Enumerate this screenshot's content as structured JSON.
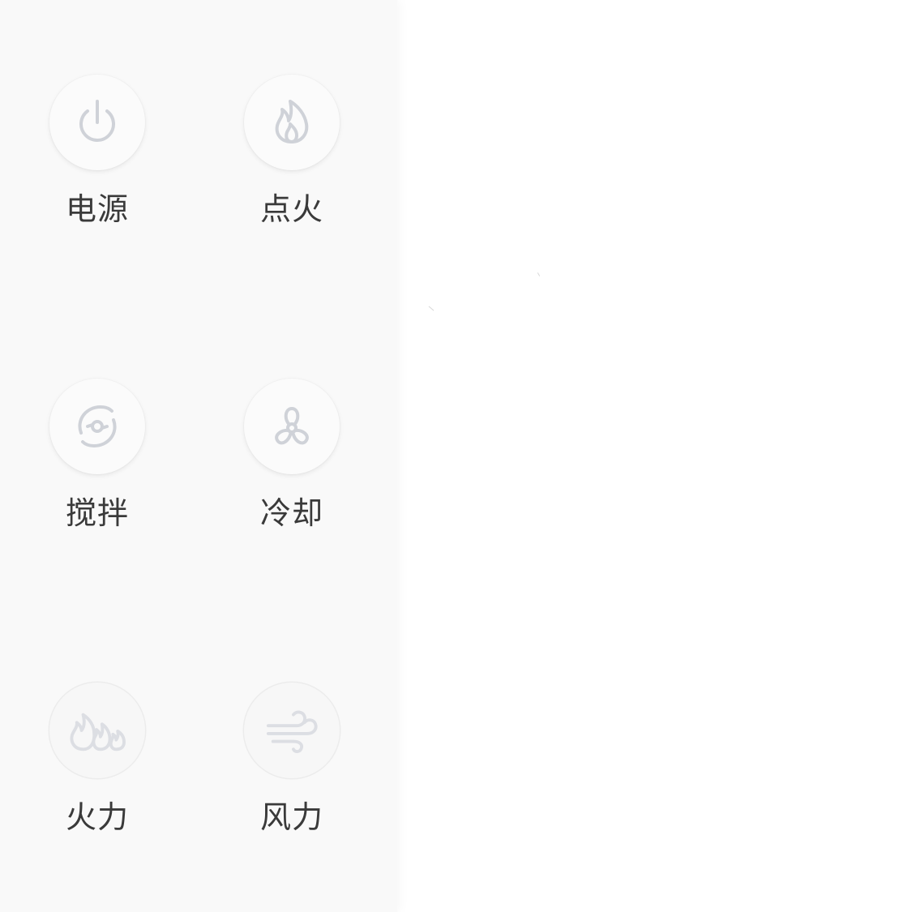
{
  "controls": [
    {
      "label": "电源",
      "icon": "power-icon",
      "enabled": true
    },
    {
      "label": "点火",
      "icon": "flame-icon",
      "enabled": true
    },
    {
      "label": "搅拌",
      "icon": "stir-icon",
      "enabled": true
    },
    {
      "label": "冷却",
      "icon": "fan-icon",
      "enabled": true
    },
    {
      "label": "火力",
      "icon": "fire-power-icon",
      "enabled": false
    },
    {
      "label": "风力",
      "icon": "wind-icon",
      "enabled": false
    }
  ],
  "colors": {
    "icon_active": "#cfd2d8",
    "icon_disabled": "#dcdee3",
    "label": "#3a3a3a",
    "panel_bg": "#f9f9f9"
  }
}
